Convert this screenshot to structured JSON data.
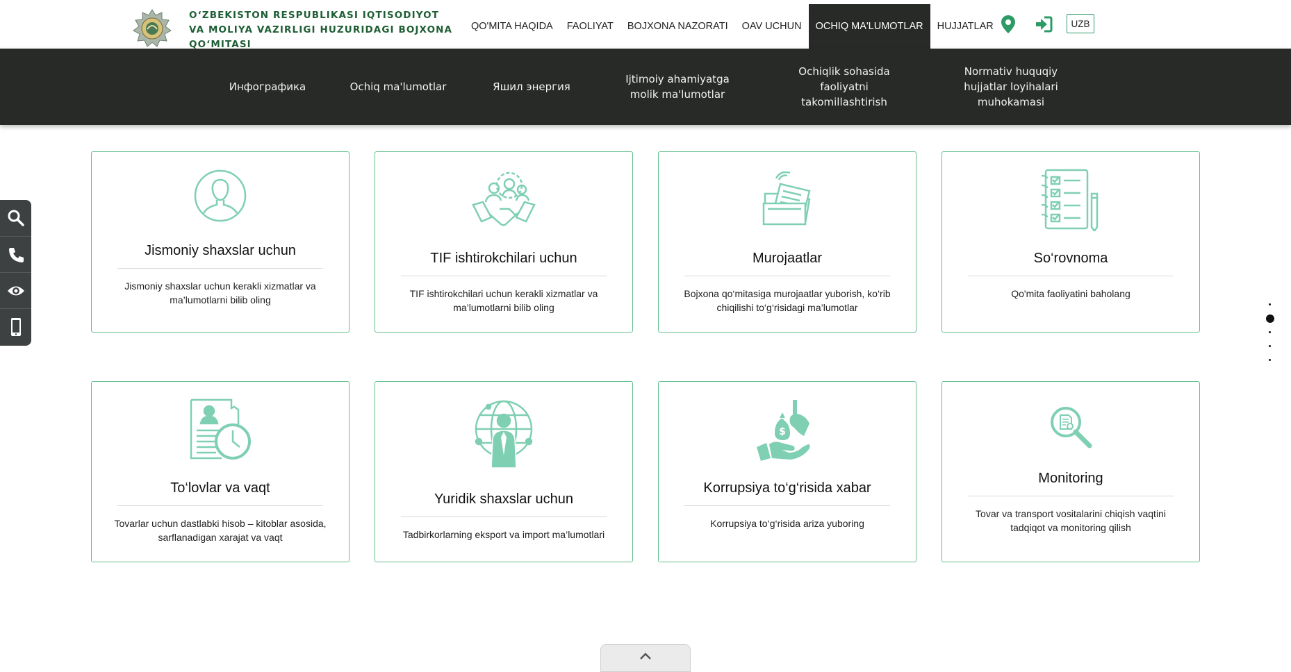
{
  "header": {
    "brand_lines": [
      "O‘ZBEKISTON RESPUBLIKASI IQTISODIYOT",
      "VA MOLIYA VAZIRLIGI HUZURIDAGI BOJXONA",
      "QO‘MITASI"
    ],
    "nav": [
      "QO'MITA HAQIDA",
      "FAOLIYAT",
      "BOJXONA NAZORATI",
      "OAV UCHUN",
      "OCHIQ MA'LUMOTLAR",
      "HUJJATLAR"
    ],
    "active_nav": "OCHIQ MA'LUMOTLAR",
    "icons": [
      "map-pin-icon",
      "login-icon"
    ],
    "language": "UZB"
  },
  "submenu": {
    "items": [
      {
        "label": "Инфографика"
      },
      {
        "label": "Ochiq ma'lumotlar"
      },
      {
        "label": "Яшил энергия"
      },
      {
        "label": "Ijtimoiy ahamiyatga molik ma'lumotlar"
      },
      {
        "label": "Ochiqlik sohasida faoliyatni takomillashtirish"
      },
      {
        "label": "Normativ huquqiy hujjatlar loyihalari muhokamasi"
      }
    ]
  },
  "sidepanel": {
    "icons": [
      "search-icon",
      "phone-icon",
      "eye-icon",
      "mobile-icon"
    ]
  },
  "cards": [
    {
      "title": "Jismoniy shaxslar uchun",
      "desc": "Jismoniy shaxslar uchun kerakli xizmatlar va ma’lumotlarni bilib oling",
      "icon": "person-icon"
    },
    {
      "title": "TIF ishtirokchilari uchun",
      "desc": "TIF ishtirokchilari uchun kerakli xizmatlar va ma’lumotlarni bilib oling",
      "icon": "handshake-icon"
    },
    {
      "title": "Murojaatlar",
      "desc": "Bojxona qo‘mitasiga murojaatlar yuborish, ko‘rib chiqilishi to‘g‘risidagi ma’lumotlar",
      "icon": "folder-icon"
    },
    {
      "title": "So‘rovnoma",
      "desc": "Qo'mita faoliyatini baholang",
      "icon": "checklist-icon"
    },
    {
      "title": "To‘lovlar va vaqt",
      "desc": "Tovarlar uchun dastlabki hisob – kitoblar asosida, sarflanadigan xarajat va vaqt",
      "icon": "receipt-clock-icon"
    },
    {
      "title": "Yuridik shaxslar uchun",
      "desc": "Tadbirkorlarning eksport va import ma’lumotlari",
      "icon": "globe-businessman-icon"
    },
    {
      "title": "Korrupsiya to‘g‘risida xabar",
      "desc": "Korrupsiya to‘g‘risida ariza yuboring",
      "icon": "bribe-hand-icon"
    },
    {
      "title": "Monitoring",
      "desc": "Tovar va transport vositalarini chiqish vaqtini tadqiqot va monitoring qilish",
      "icon": "magnifier-document-icon"
    }
  ],
  "pager": {
    "count": 5,
    "active_index": 1
  },
  "colors": {
    "accent": "#62c08d",
    "icon": "#7fcfb2",
    "dark_bar": "#272a27",
    "brand": "#1f5e35",
    "nav_icon": "#2e9b67"
  }
}
